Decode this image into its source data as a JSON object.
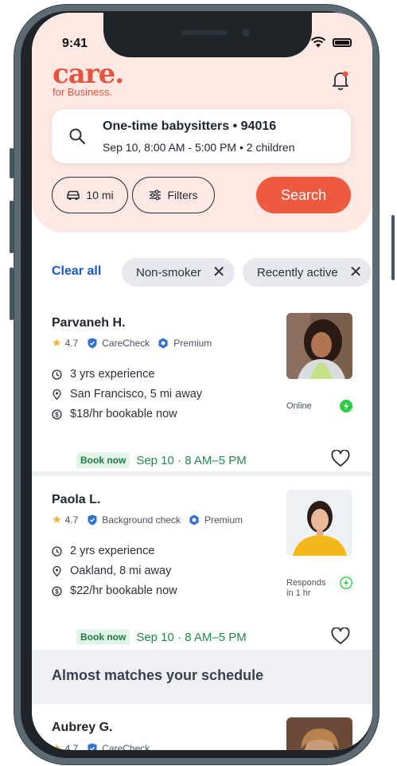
{
  "status_bar": {
    "time": "9:41"
  },
  "brand": {
    "logo_word": "care.",
    "logo_sub": "for Business."
  },
  "search": {
    "title": "One-time babysitters • 94016",
    "subtitle": "Sep 10, 8:00 AM - 5:00 PM • 2 children",
    "distance_label": "10 mi",
    "filters_label": "Filters",
    "search_button_label": "Search"
  },
  "filters": {
    "clear_all_label": "Clear all",
    "chips": [
      "Non-smoker",
      "Recently active"
    ]
  },
  "results": [
    {
      "name": "Parvaneh H.",
      "rating": "4.7",
      "check_label": "CareCheck",
      "tier_label": "Premium",
      "experience": "3 yrs experience",
      "location": "San Francisco, 5 mi away",
      "rate": "$18/hr bookable now",
      "book_badge": "Book now",
      "book_time": "Sep 10 · 8 AM–5 PM",
      "availability": "Online"
    },
    {
      "name": "Paola L.",
      "rating": "4.7",
      "check_label": "Background check",
      "tier_label": "Premium",
      "experience": "2 yrs experience",
      "location": "Oakland, 8 mi away",
      "rate": "$22/hr bookable now",
      "book_badge": "Book now",
      "book_time": "Sep 10 · 8 AM–5 PM",
      "availability_line1": "Responds",
      "availability_line2": "in 1 hr"
    }
  ],
  "almost_matches": {
    "heading": "Almost matches your schedule",
    "first": {
      "name": "Aubrey G.",
      "rating": "4.7",
      "check_label": "CareCheck"
    }
  },
  "colors": {
    "brand": "#e8533f",
    "search_button": "#ee5a3f",
    "header_bg": "#fde8e3",
    "link_blue": "#1b55c9",
    "book_green": "#1e8a4c",
    "online_green": "#2ecc40"
  }
}
